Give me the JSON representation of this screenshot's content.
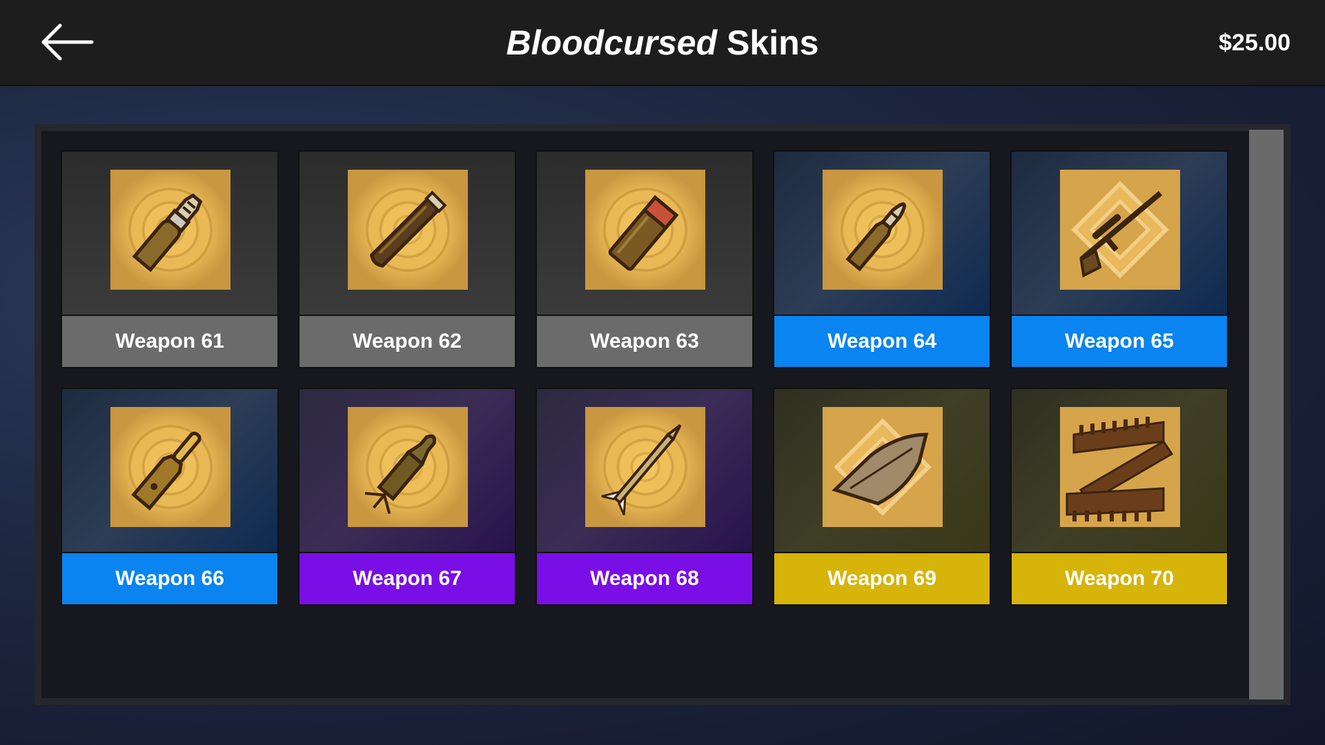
{
  "header": {
    "title_italic": "Bloodcursed",
    "title_plain": "Skins",
    "balance": "$25.00",
    "back_icon": "arrow-left-icon"
  },
  "colors": {
    "common_label": "#6b6b6b",
    "rare_label": "#0a84f0",
    "epic_label": "#7a0ee6",
    "legendary_label": "#d6b40a",
    "icon_gold": "#e9b955",
    "icon_ink": "#3b2410"
  },
  "skins": [
    {
      "label": "Weapon 61",
      "rarity": "common",
      "icon": "bullet-shell-icon"
    },
    {
      "label": "Weapon 62",
      "rarity": "common",
      "icon": "tube-icon"
    },
    {
      "label": "Weapon 63",
      "rarity": "common",
      "icon": "grenade-canister-icon"
    },
    {
      "label": "Weapon 64",
      "rarity": "rare",
      "icon": "rifle-round-icon"
    },
    {
      "label": "Weapon 65",
      "rarity": "rare",
      "icon": "sniper-rifle-icon"
    },
    {
      "label": "Weapon 66",
      "rarity": "rare",
      "icon": "shotgun-shell-icon"
    },
    {
      "label": "Weapon 67",
      "rarity": "epic",
      "icon": "rocket-round-icon"
    },
    {
      "label": "Weapon 68",
      "rarity": "epic",
      "icon": "arrow-bolt-icon"
    },
    {
      "label": "Weapon 69",
      "rarity": "legendary",
      "icon": "shrapnel-icon"
    },
    {
      "label": "Weapon 70",
      "rarity": "legendary",
      "icon": "ammo-belt-icon"
    }
  ]
}
